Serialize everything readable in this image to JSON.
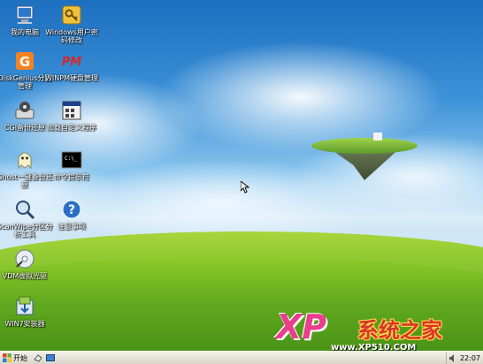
{
  "desktop_icons": [
    {
      "id": "my-computer",
      "label": "我的电脑",
      "icon": "computer-icon"
    },
    {
      "id": "windows-password",
      "label": "Windows用户密码修改",
      "icon": "key-icon"
    },
    {
      "id": "diskgenius",
      "label": "DiskGenius分区管理",
      "icon": "diskgenius-icon"
    },
    {
      "id": "winpm",
      "label": "WINPM硬盘管理",
      "icon": "pm-icon"
    },
    {
      "id": "cgi-backup",
      "label": "CGI备份还原",
      "icon": "cgi-icon"
    },
    {
      "id": "custom-tool",
      "label": "加载自定义程序",
      "icon": "program-icon"
    },
    {
      "id": "ghost",
      "label": "Ghost一键备份还原",
      "icon": "ghost-icon"
    },
    {
      "id": "cmd",
      "label": "命令提示符",
      "icon": "cmd-icon"
    },
    {
      "id": "scanwipe",
      "label": "ScanWipe分区分析工具",
      "icon": "scan-icon"
    },
    {
      "id": "help",
      "label": "注意事项",
      "icon": "help-icon"
    },
    {
      "id": "vdm",
      "label": "VDM虚拟光驱",
      "icon": "cd-icon"
    },
    {
      "id": "win7-installer",
      "label": "WIN7安装器",
      "icon": "installer-icon"
    }
  ],
  "taskbar": {
    "start_label": "开始",
    "clock": "22:07"
  },
  "watermark": {
    "brand_xp": "XP",
    "brand_cn": "系统之家",
    "url": "www.XP510.COM"
  },
  "colors": {
    "sky_top": "#1d6fc0",
    "grass": "#5fa81e",
    "watermark_pink": "#e83e8c",
    "watermark_red": "#d9342b"
  }
}
